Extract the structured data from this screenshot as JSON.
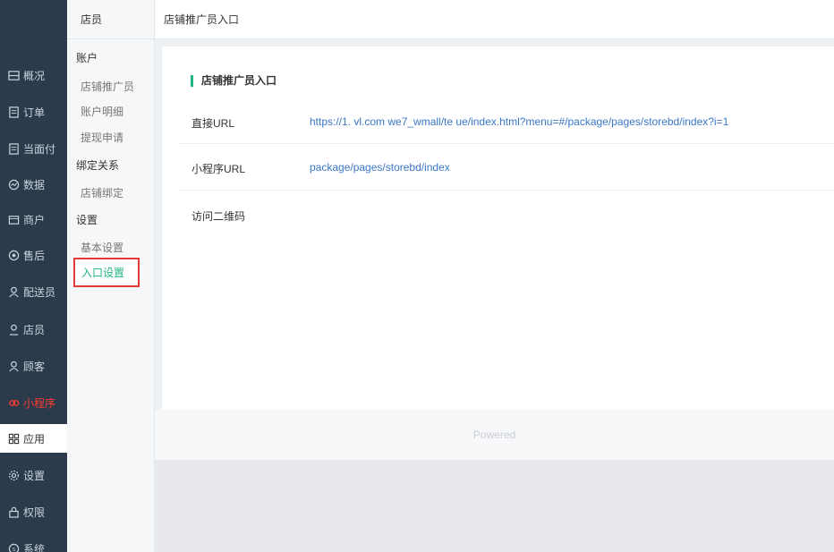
{
  "main_nav": [
    {
      "label": "概况",
      "icon": "overview-icon"
    },
    {
      "label": "订单",
      "icon": "order-icon"
    },
    {
      "label": "当面付",
      "icon": "facepay-icon"
    },
    {
      "label": "数据",
      "icon": "data-icon"
    },
    {
      "label": "商户",
      "icon": "store-icon"
    },
    {
      "label": "售后",
      "icon": "aftersale-icon"
    },
    {
      "label": "配送员",
      "icon": "courier-icon"
    },
    {
      "label": "店员",
      "icon": "clerk-icon"
    },
    {
      "label": "顾客",
      "icon": "customer-icon"
    },
    {
      "label": "小程序",
      "icon": "miniprogram-icon"
    },
    {
      "label": "应用",
      "icon": "apps-icon"
    },
    {
      "label": "设置",
      "icon": "settings-icon"
    },
    {
      "label": "权限",
      "icon": "lock-icon"
    },
    {
      "label": "系统",
      "icon": "system-icon"
    }
  ],
  "sub_nav": {
    "header": "店员",
    "groups": {
      "account": "账户",
      "binding": "绑定关系",
      "settings": "设置"
    },
    "items": {
      "promoter": "店铺推广员",
      "account_detail": "账户明细",
      "withdraw": "提现申请",
      "store_binding": "店铺绑定",
      "basic_settings": "基本设置",
      "entry_settings": "入口设置"
    }
  },
  "top_bar": {
    "title": "店铺推广员入口"
  },
  "panel": {
    "section_title": "店铺推广员入口",
    "rows": {
      "direct_url_label": "直接URL",
      "direct_url_value": "https://1.          vl.com             we7_wmall/te              ue/index.html?menu=#/package/pages/storebd/index?i=1",
      "mini_url_label": "小程序URL",
      "mini_url_value": "package/pages/storebd/index",
      "qrcode_label": "访问二维码"
    }
  },
  "footer": {
    "text": "Powered"
  },
  "colors": {
    "accent": "#21b384",
    "sidebar": "#2b3b4c",
    "link": "#3a77c8",
    "highlight": "#e53935"
  }
}
